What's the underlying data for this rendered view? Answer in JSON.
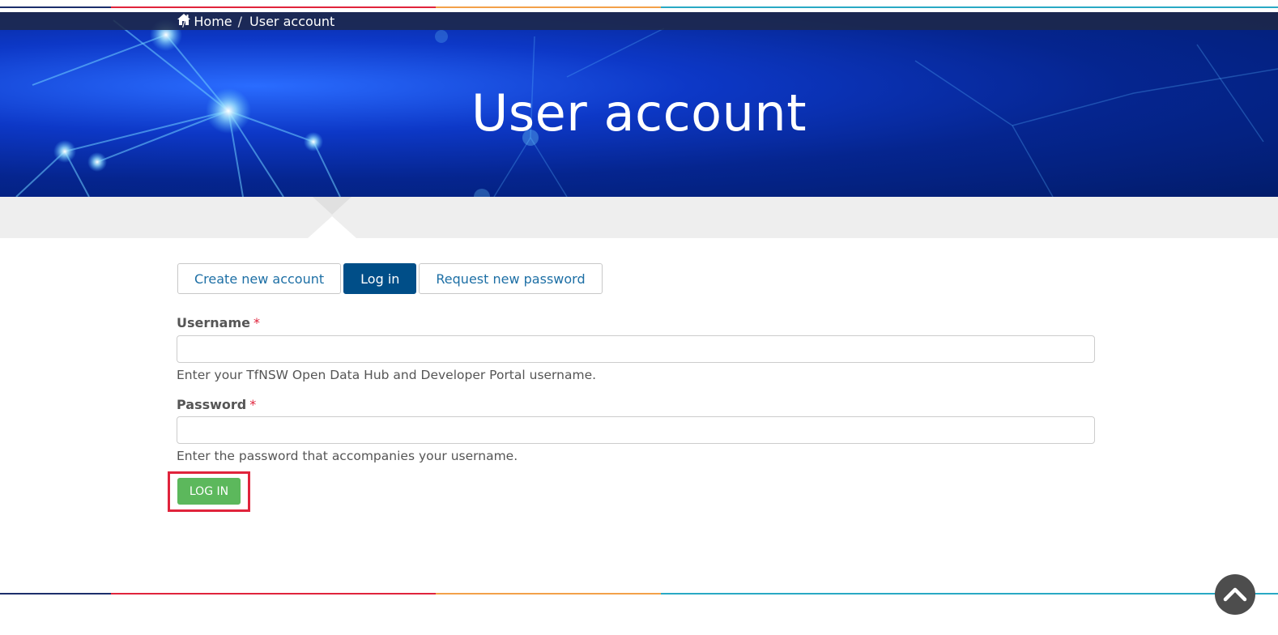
{
  "breadcrumb": {
    "home_icon": "home-icon",
    "items": [
      "Home",
      "User account"
    ],
    "separator": "/"
  },
  "hero": {
    "title": "User account"
  },
  "tabs": [
    {
      "label": "Create new account",
      "active": false
    },
    {
      "label": "Log in",
      "active": true
    },
    {
      "label": "Request new password",
      "active": false
    }
  ],
  "form": {
    "username": {
      "label": "Username",
      "required_marker": "*",
      "value": "",
      "help": "Enter your TfNSW Open Data Hub and Developer Portal username."
    },
    "password": {
      "label": "Password",
      "required_marker": "*",
      "value": "",
      "help": "Enter the password that accompanies your username."
    },
    "submit_label": "LOG IN"
  },
  "scroll_top": {
    "icon": "chevron-up-icon"
  },
  "colors": {
    "accent_navy": "#1c2f6b",
    "accent_red": "#e0243c",
    "accent_orange": "#f3a14a",
    "accent_teal": "#29a9c4",
    "tab_active": "#004e88",
    "link": "#1d6fa5",
    "button_green": "#5cb85c",
    "highlight": "#e0243c"
  }
}
